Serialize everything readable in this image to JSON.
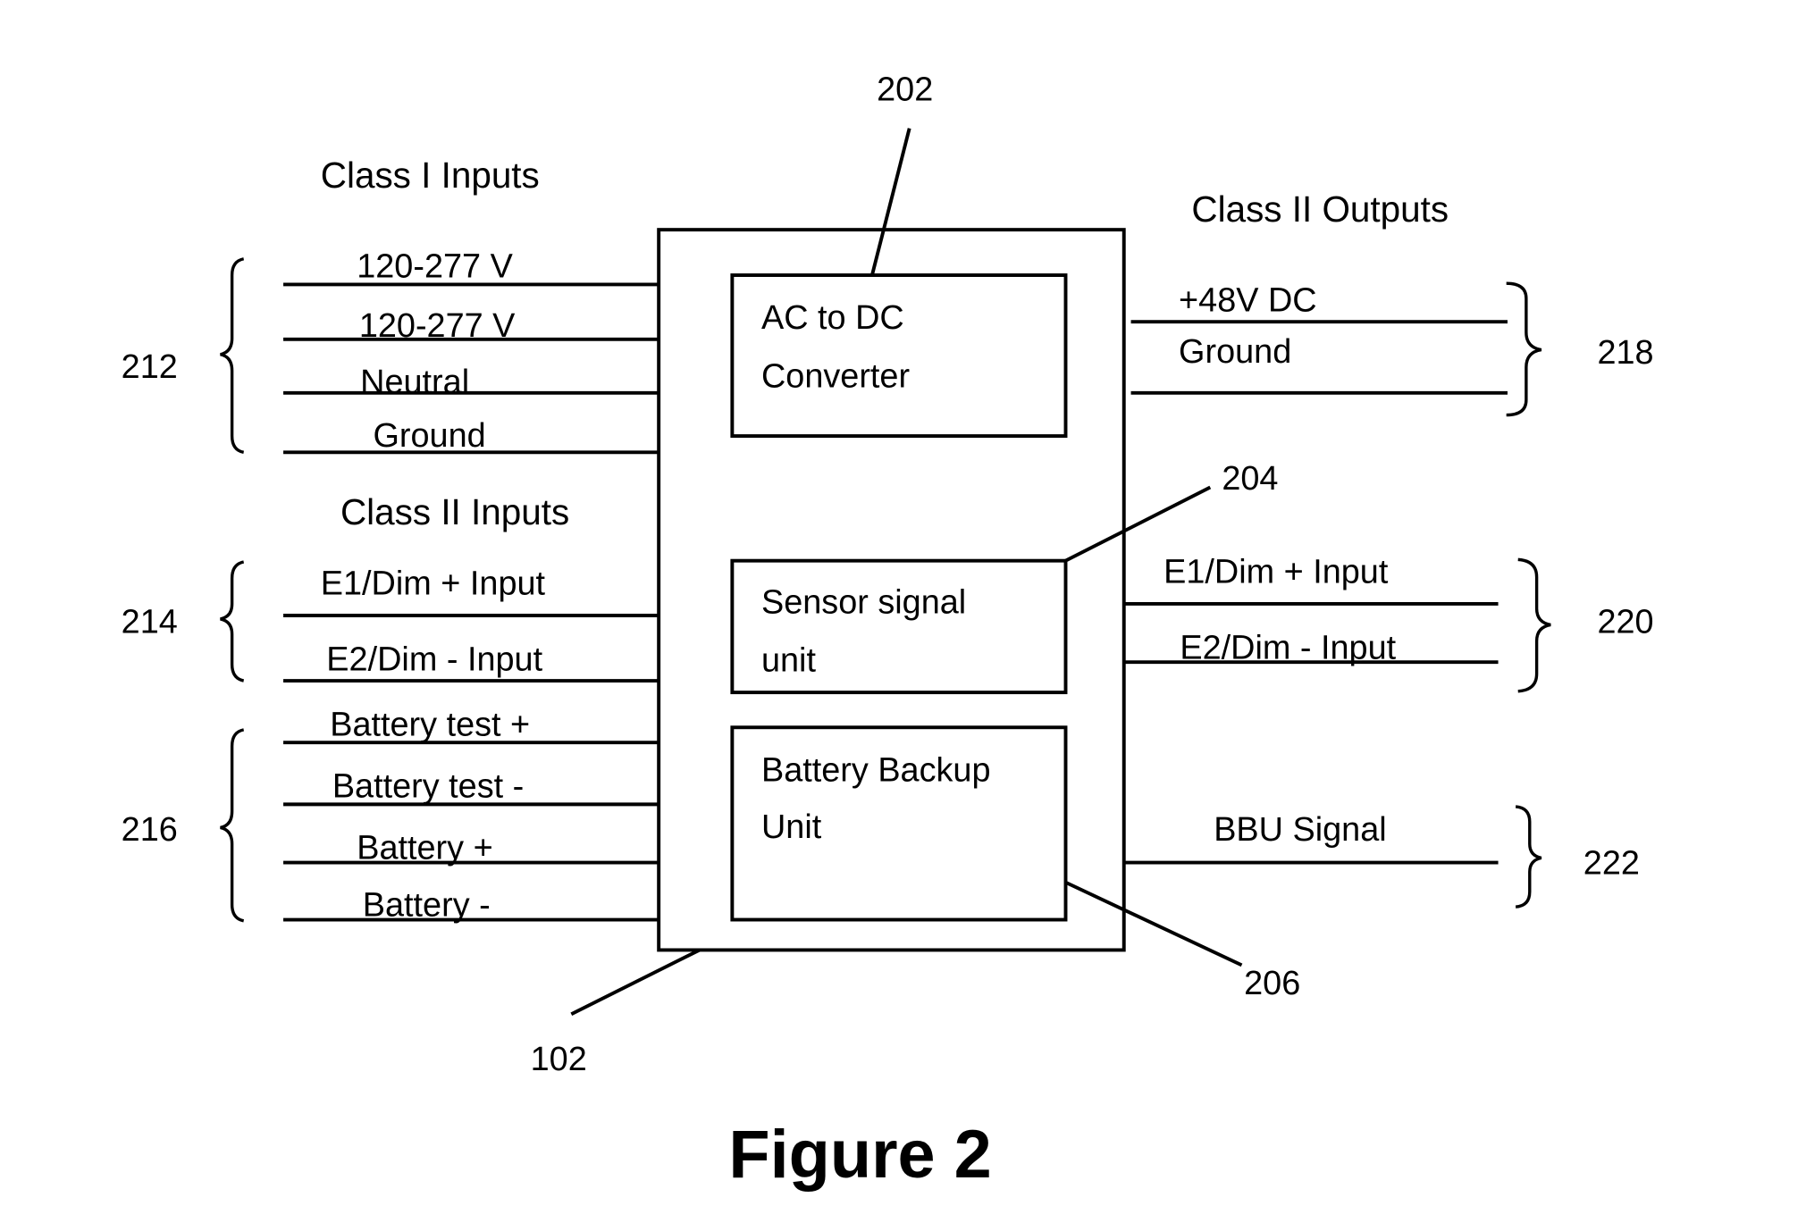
{
  "figure": {
    "caption": "Figure 2",
    "device_ref": "102",
    "headings": {
      "class1_inputs": "Class I Inputs",
      "class2_inputs": "Class II Inputs",
      "class2_outputs": "Class II Outputs"
    },
    "blocks": {
      "ac_dc": {
        "ref": "202",
        "line1": "AC to DC",
        "line2": "Converter"
      },
      "sensor": {
        "ref": "204",
        "line1": "Sensor signal",
        "line2": "unit"
      },
      "bbu": {
        "ref": "206",
        "line1": "Battery Backup",
        "line2": "Unit"
      }
    },
    "input_groups": [
      {
        "ref": "212",
        "signals": [
          "120-277 V",
          "120-277 V",
          "Neutral",
          "Ground"
        ]
      },
      {
        "ref": "214",
        "signals": [
          "E1/Dim + Input",
          "E2/Dim - Input"
        ]
      },
      {
        "ref": "216",
        "signals": [
          "Battery test +",
          "Battery test -",
          "Battery +",
          "Battery -"
        ]
      }
    ],
    "output_groups": [
      {
        "ref": "218",
        "signals": [
          "+48V DC",
          "Ground"
        ]
      },
      {
        "ref": "220",
        "signals": [
          "E1/Dim + Input",
          "E2/Dim - Input"
        ]
      },
      {
        "ref": "222",
        "signals": [
          "BBU Signal"
        ]
      }
    ]
  }
}
